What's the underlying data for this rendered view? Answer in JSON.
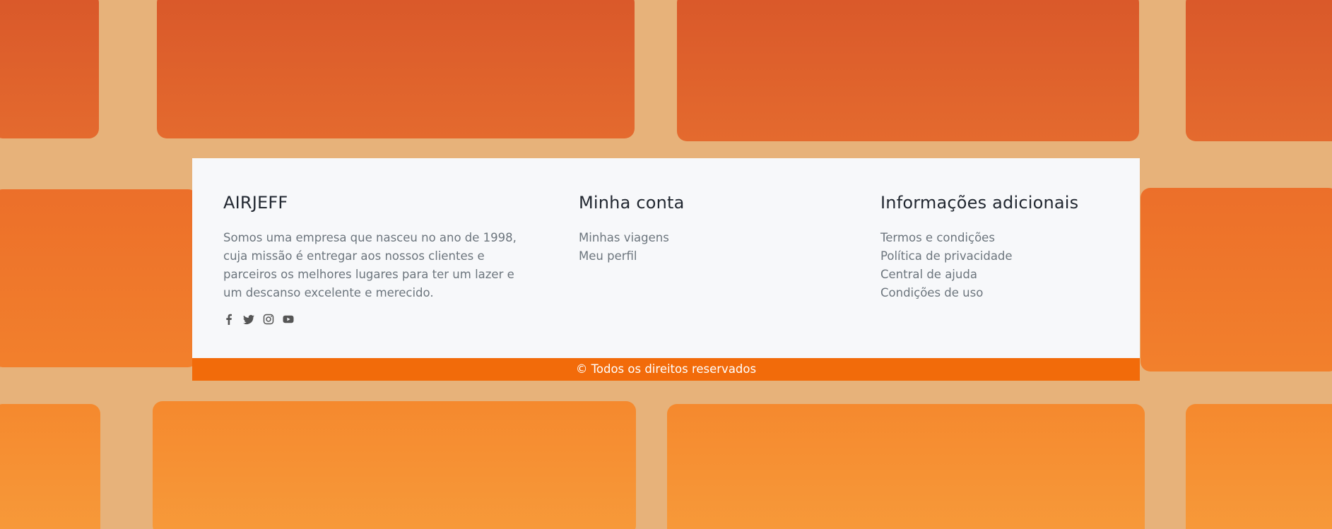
{
  "colors": {
    "footer_bg": "#f7f8fa",
    "accent": "#f26b0a",
    "heading": "#222831",
    "text": "#6c757d",
    "mortar": "#e7b27a"
  },
  "brand": {
    "title": "AIRJEFF",
    "description": "Somos uma empresa que nasceu no ano de 1998, cuja missão é entregar aos nossos clientes e parceiros os melhores lugares para ter um lazer e um descanso excelente e merecido.",
    "social": [
      {
        "icon": "facebook-icon"
      },
      {
        "icon": "twitter-icon"
      },
      {
        "icon": "instagram-icon"
      },
      {
        "icon": "youtube-icon"
      }
    ]
  },
  "account": {
    "title": "Minha conta",
    "links": [
      "Minhas viagens",
      "Meu perfil"
    ]
  },
  "info": {
    "title": "Informações adicionais",
    "links": [
      "Termos e condições",
      "Política de privacidade",
      "Central de ajuda",
      "Condições de uso"
    ]
  },
  "copyright": "© Todos os direitos reservados"
}
